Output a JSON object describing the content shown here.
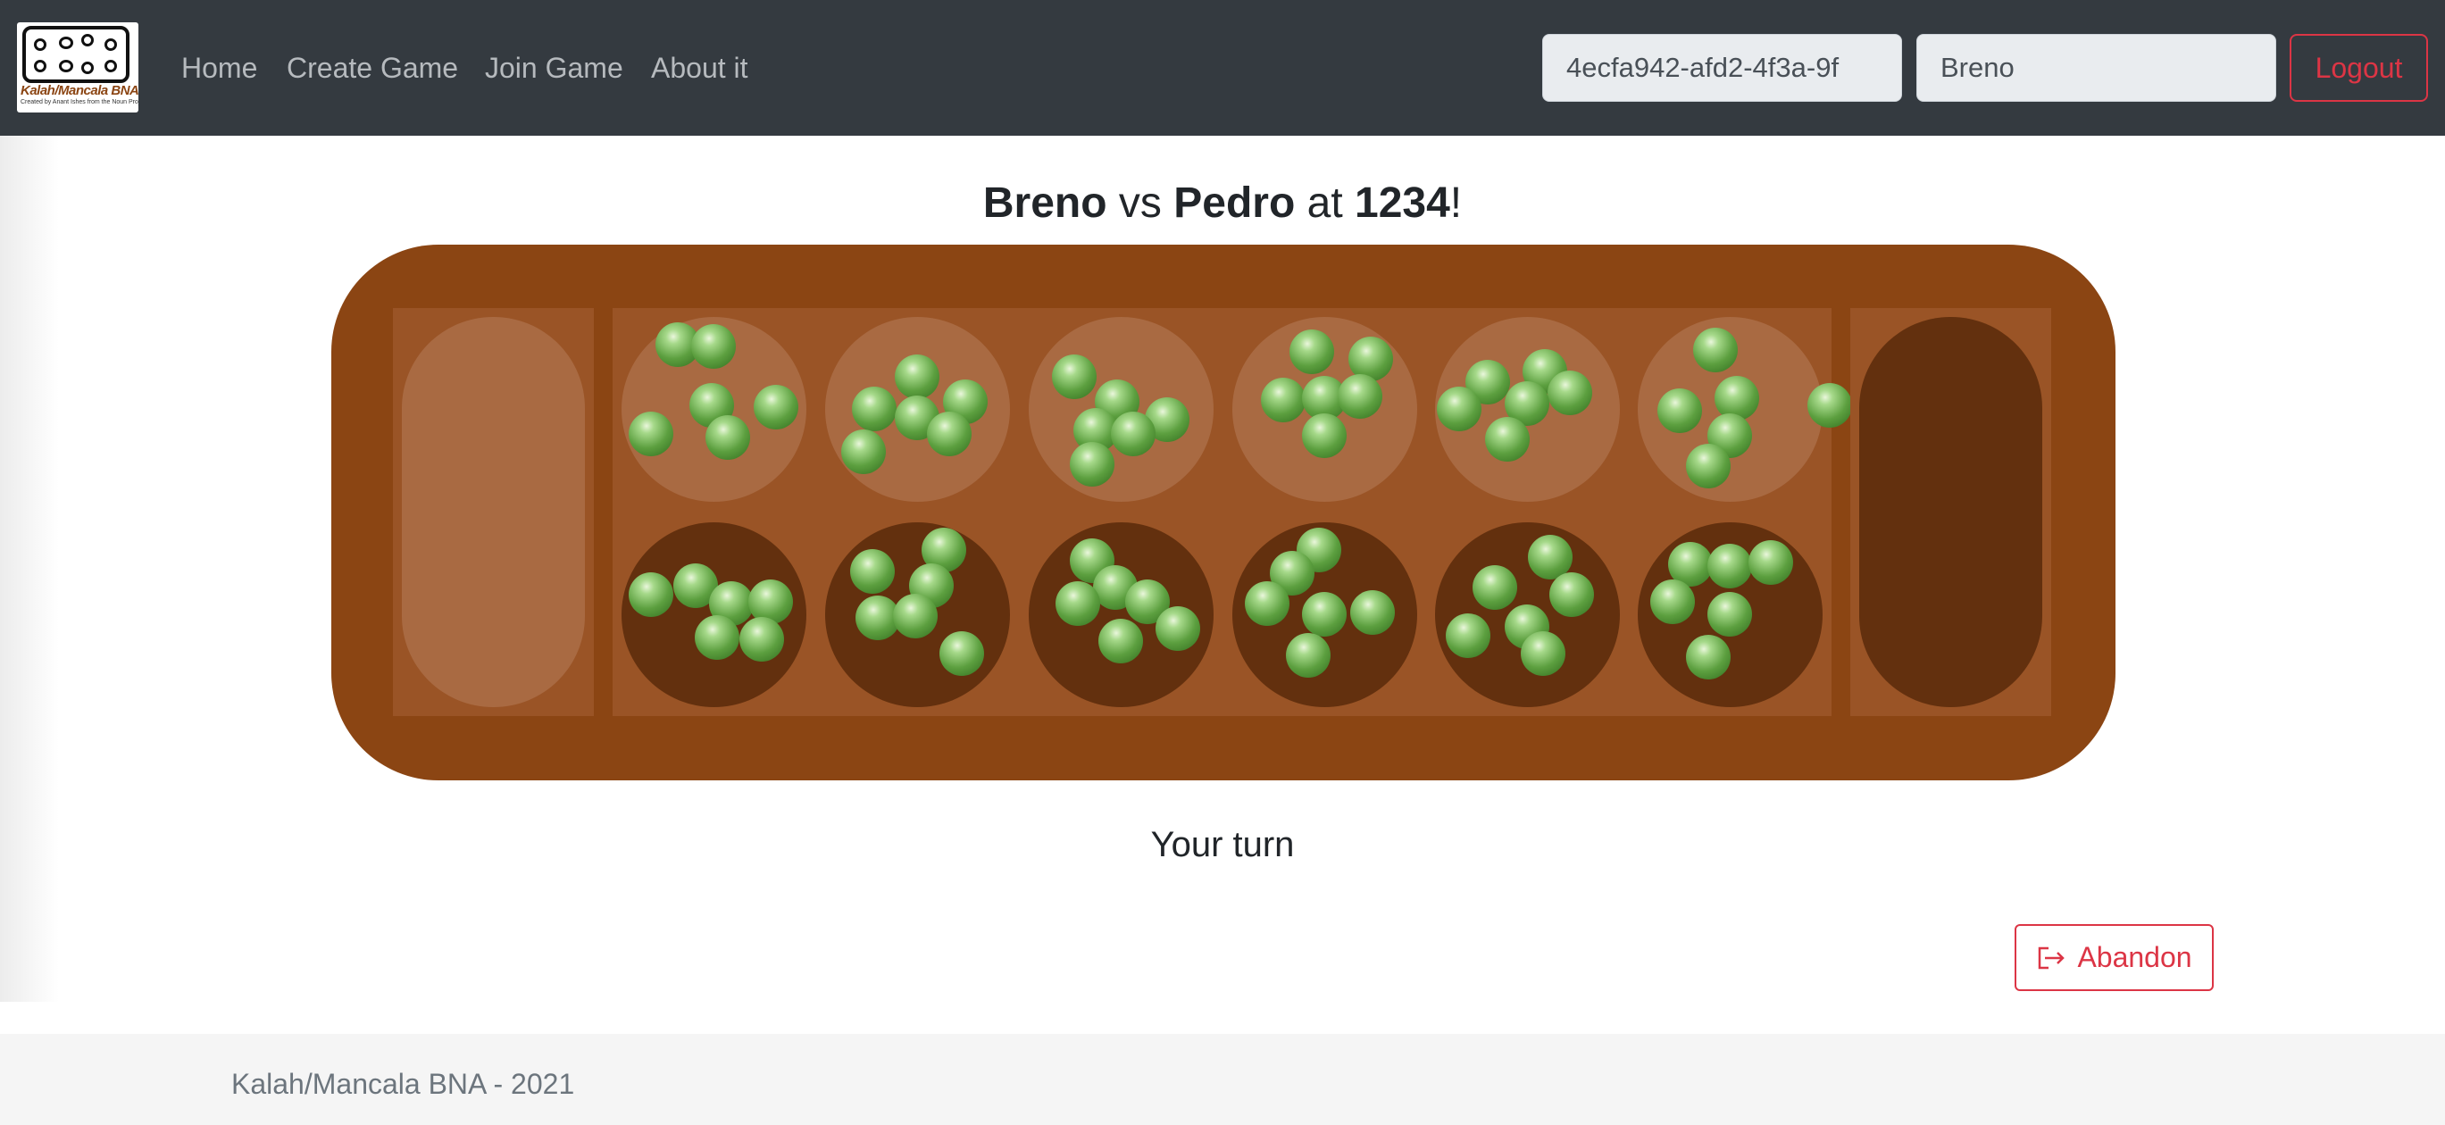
{
  "navbar": {
    "logo_title": "Kalah/Mancala BNA",
    "logo_subtitle": "Created by Anant Ishes from the Noun Project",
    "links": [
      "Home",
      "Create Game",
      "Join Game",
      "About it"
    ],
    "game_id_value": "4ecfa942-afd2-4f3a-9f",
    "player_name_value": "Breno",
    "logout_label": "Logout"
  },
  "game": {
    "player1": "Breno",
    "vs_text": "vs",
    "player2": "Pedro",
    "at_text": "at",
    "room": "1234",
    "exclamation": "!",
    "turn_status": "Your turn",
    "abandon_label": "Abandon",
    "board": {
      "store_left_seeds": 0,
      "store_right_seeds": 0,
      "top_row_seeds": [
        6,
        6,
        6,
        6,
        6,
        6
      ],
      "bottom_row_seeds": [
        6,
        6,
        6,
        6,
        6,
        6
      ],
      "colors": {
        "board": "#8b4513",
        "inner": "#9a5426",
        "top_pit": "#a96a42",
        "bottom_pit": "#63300e",
        "seed": "#5c9f3f"
      }
    },
    "icons": {
      "abandon": "sign-out-icon"
    }
  },
  "footer": {
    "text": "Kalah/Mancala BNA - 2021"
  },
  "colors": {
    "navbar_bg": "#343a40",
    "danger": "#dc3545"
  }
}
